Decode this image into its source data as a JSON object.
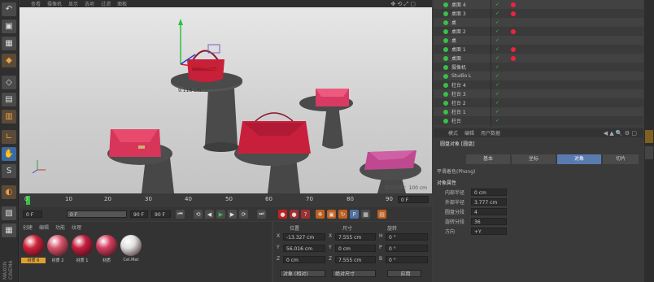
{
  "viewport": {
    "menu": [
      "查看",
      "摄像机",
      "显示",
      "选项",
      "过滤",
      "面板"
    ],
    "measure_label": "9.118 cm",
    "grid_spacing": "网格间距：100 cm"
  },
  "timeline": {
    "ticks": [
      "0",
      "10",
      "20",
      "30",
      "40",
      "50",
      "60",
      "70",
      "80",
      "90"
    ],
    "current_frame": "0 F"
  },
  "transport": {
    "start": "0 F",
    "preview_start": "0 F",
    "preview_end": "90 F",
    "end": "90 F"
  },
  "materials": {
    "menu": [
      "创建",
      "编辑",
      "功能",
      "纹理"
    ],
    "items": [
      {
        "label": "材质 6",
        "color": "#d0223a"
      },
      {
        "label": "材质 2",
        "color": "#d8556c"
      },
      {
        "label": "材质 1",
        "color": "#c61e3e"
      },
      {
        "label": "材质",
        "color": "#d43e60"
      },
      {
        "label": "Cel.Mat",
        "color": "#e0e0e0"
      }
    ]
  },
  "coords": {
    "headers": {
      "position": "位置",
      "size": "尺寸",
      "rotation": "旋转"
    },
    "rows": [
      {
        "axis": "X",
        "pos": "-13.327 cm",
        "size_axis": "X",
        "size": "7.555 cm",
        "rot_axis": "H",
        "rot": "0 °"
      },
      {
        "axis": "Y",
        "pos": "56.016 cm",
        "size_axis": "Y",
        "size": "0 cm",
        "rot_axis": "P",
        "rot": "0 °"
      },
      {
        "axis": "Z",
        "pos": "0 cm",
        "size_axis": "Z",
        "size": "7.555 cm",
        "rot_axis": "B",
        "rot": "0 °"
      }
    ],
    "mode": "对象 (相对)",
    "size_mode": "绝对尺寸",
    "apply": "应用"
  },
  "objects": {
    "rows": [
      {
        "name": "桌面 4",
        "tag": true
      },
      {
        "name": "桌面 3",
        "tag": true
      },
      {
        "name": "桌",
        "tag": false
      },
      {
        "name": "桌面 2",
        "tag": true
      },
      {
        "name": "桌",
        "tag": false
      },
      {
        "name": "桌面 1",
        "tag": true
      },
      {
        "name": "桌面",
        "tag": true
      },
      {
        "name": "摄像机",
        "tag": false
      },
      {
        "name": "Studio L",
        "tag": false
      },
      {
        "name": "柱台 4",
        "tag": false
      },
      {
        "name": "柱台 3",
        "tag": false
      },
      {
        "name": "柱台 2",
        "tag": false
      },
      {
        "name": "柱台 1",
        "tag": false
      },
      {
        "name": "柱台",
        "tag": false
      }
    ]
  },
  "attrs": {
    "menu": [
      "模式",
      "编辑",
      "用户数据"
    ],
    "object_title": "圆盘对象 [圆盘]",
    "tabs": [
      "基本",
      "坐标",
      "对象",
      "切片"
    ],
    "active_tab": "对象",
    "phong": "平滑着色(Phong)",
    "section": "对象属性",
    "props": [
      {
        "label": "内部半径",
        "value": "0 cm"
      },
      {
        "label": "外部半径",
        "value": "3.777 cm"
      },
      {
        "label": "圆盘分段",
        "value": "4"
      },
      {
        "label": "旋转分段",
        "value": "36"
      },
      {
        "label": "方向",
        "value": "+Y"
      }
    ]
  }
}
